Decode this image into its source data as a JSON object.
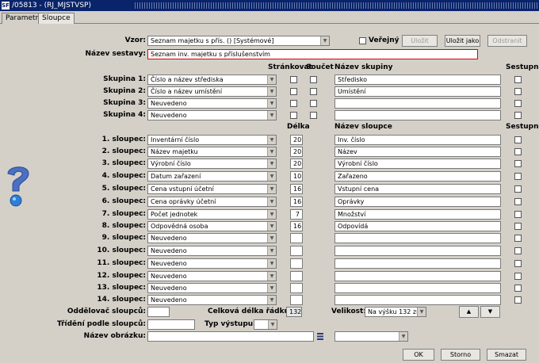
{
  "window": {
    "logo": "SF",
    "title": "/05813 - (RJ_MJSTVSP)"
  },
  "tabs": [
    {
      "label": "Parametry"
    },
    {
      "label": "Sloupce"
    }
  ],
  "top": {
    "vzor_label": "Vzor:",
    "vzor_value": "Seznam majetku s přís.   ()   [Systémové]",
    "verejny_label": "Veřejný",
    "ulozit_label": "Uložit",
    "ulozit_jako_label": "Uložit jako",
    "odstranit_label": "Odstranit",
    "nazev_sestavy_label": "Název sestavy:",
    "nazev_sestavy_value": "Seznam inv. majetku s příslušenstvím"
  },
  "groups_header": {
    "strankovat": "Stránkovat",
    "soucet": "Součet",
    "nazev_skupiny": "Název skupiny",
    "sestupne": "Sestupně"
  },
  "groups": [
    {
      "label": "Skupina 1:",
      "value": "Číslo a název střediska",
      "name": "Středisko"
    },
    {
      "label": "Skupina 2:",
      "value": "Číslo a název umístění",
      "name": "Umístění"
    },
    {
      "label": "Skupina 3:",
      "value": "Neuvedeno",
      "name": ""
    },
    {
      "label": "Skupina 4:",
      "value": "Neuvedeno",
      "name": ""
    }
  ],
  "columns_header": {
    "delka": "Délka",
    "nazev_sloupce": "Název sloupce",
    "sestupne": "Sestupně"
  },
  "columns": [
    {
      "label": "1. sloupec:",
      "value": "Inventární číslo",
      "length": "20",
      "name": "Inv. číslo"
    },
    {
      "label": "2. sloupec:",
      "value": "Název majetku",
      "length": "20",
      "name": "Název"
    },
    {
      "label": "3. sloupec:",
      "value": "Výrobní číslo",
      "length": "20",
      "name": "Výrobní číslo"
    },
    {
      "label": "4. sloupec:",
      "value": "Datum zařazení",
      "length": "10",
      "name": "Zařazeno"
    },
    {
      "label": "5. sloupec:",
      "value": "Cena vstupní účetní",
      "length": "16",
      "name": "Vstupní cena"
    },
    {
      "label": "6. sloupec:",
      "value": "Cena oprávky účetní",
      "length": "16",
      "name": "Oprávky"
    },
    {
      "label": "7. sloupec:",
      "value": "Počet jednotek",
      "length": "7",
      "name": "Množství"
    },
    {
      "label": "8. sloupec:",
      "value": "Odpovědná osoba",
      "length": "16",
      "name": "Odpovídá"
    },
    {
      "label": "9. sloupec:",
      "value": "Neuvedeno",
      "length": "",
      "name": ""
    },
    {
      "label": "10. sloupec:",
      "value": "Neuvedeno",
      "length": "",
      "name": ""
    },
    {
      "label": "11. sloupec:",
      "value": "Neuvedeno",
      "length": "",
      "name": ""
    },
    {
      "label": "12. sloupec:",
      "value": "Neuvedeno",
      "length": "",
      "name": ""
    },
    {
      "label": "13. sloupec:",
      "value": "Neuvedeno",
      "length": "",
      "name": ""
    },
    {
      "label": "14. sloupec:",
      "value": "Neuvedeno",
      "length": "",
      "name": ""
    }
  ],
  "bottom": {
    "oddelovac_label": "Oddělovač sloupců:",
    "oddelovac_value": "",
    "celkova_delka_label": "Celková délka řádku:",
    "celkova_delka_value": "132",
    "velikost_label": "Velikost:",
    "velikost_value": "Na výšku 132 zn.",
    "trideni_label": "Třídění podle sloupců:",
    "trideni_value": "",
    "typ_vystupu_label": "Typ výstupu:",
    "typ_vystupu_value": "",
    "nazev_obrazku_label": "Název obrázku:",
    "nazev_obrazku_value": "",
    "obrazek_combo_value": ""
  },
  "buttons": {
    "ok": "OK",
    "storno": "Storno",
    "smazat": "Smazat"
  },
  "icons": {
    "help": "help-question-icon",
    "up": "arrow-up-icon",
    "down": "arrow-down-icon",
    "browse": "list-browse-icon"
  }
}
